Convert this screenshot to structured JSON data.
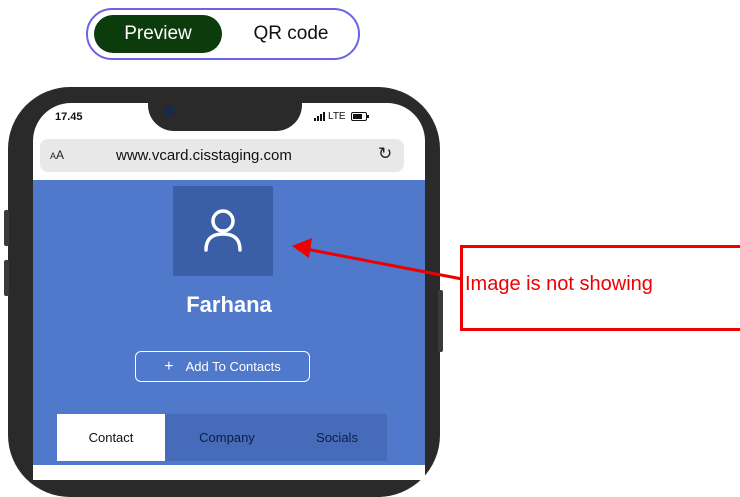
{
  "toggle": {
    "preview_label": "Preview",
    "qr_label": "QR code"
  },
  "phone": {
    "status_time": "17.45",
    "network": "LTE",
    "browser": {
      "text_size_label_small": "A",
      "text_size_label_large": "A",
      "url": "www.vcard.cisstaging.com",
      "reload_glyph": "↻"
    }
  },
  "profile": {
    "name": "Farhana",
    "add_contacts_label": "Add To Contacts",
    "add_icon_glyph": "+"
  },
  "tabs": [
    {
      "label": "Contact",
      "active": true
    },
    {
      "label": "Company",
      "active": false
    },
    {
      "label": "Socials",
      "active": false
    }
  ],
  "annotation": {
    "text": "Image is not showing",
    "color": "#e00000"
  },
  "colors": {
    "hero_blue": "#5078cb",
    "toggle_active": "#0c3b0c",
    "toggle_border": "#6b62e6"
  },
  "icons": {
    "avatar": "user-icon",
    "reload": "reload-icon",
    "signal": "signal-icon",
    "battery": "battery-icon",
    "add": "plus-icon",
    "arrow": "arrow-icon"
  }
}
